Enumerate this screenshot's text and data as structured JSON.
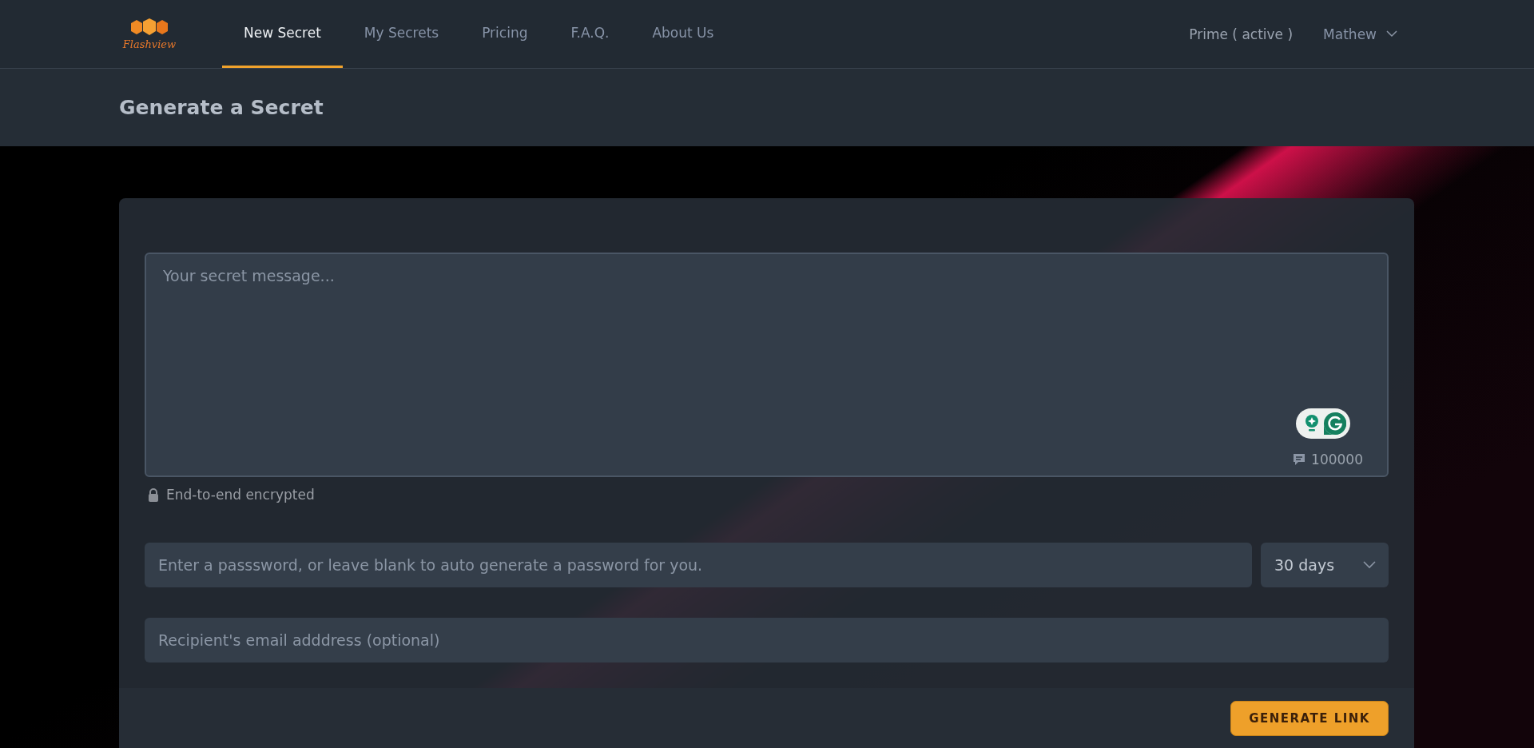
{
  "header": {
    "logo_text": "Flashview",
    "nav": [
      {
        "label": "New Secret",
        "selected": true
      },
      {
        "label": "My Secrets",
        "selected": false
      },
      {
        "label": "Pricing",
        "selected": false
      },
      {
        "label": "F.A.Q.",
        "selected": false
      },
      {
        "label": "About Us",
        "selected": false
      }
    ],
    "plan": "Prime ( active )",
    "user": "Mathew"
  },
  "page_title": "Generate a Secret",
  "form": {
    "message": {
      "placeholder": "Your secret message..."
    },
    "char_count": "100000",
    "encryption_note": "End-to-end encrypted",
    "password": {
      "placeholder": "Enter a passsword, or leave blank to auto generate a password for you."
    },
    "expiry": "30 days",
    "email": {
      "placeholder": "Recipient's email adddress (optional)"
    },
    "submit": "GENERATE LINK"
  }
}
